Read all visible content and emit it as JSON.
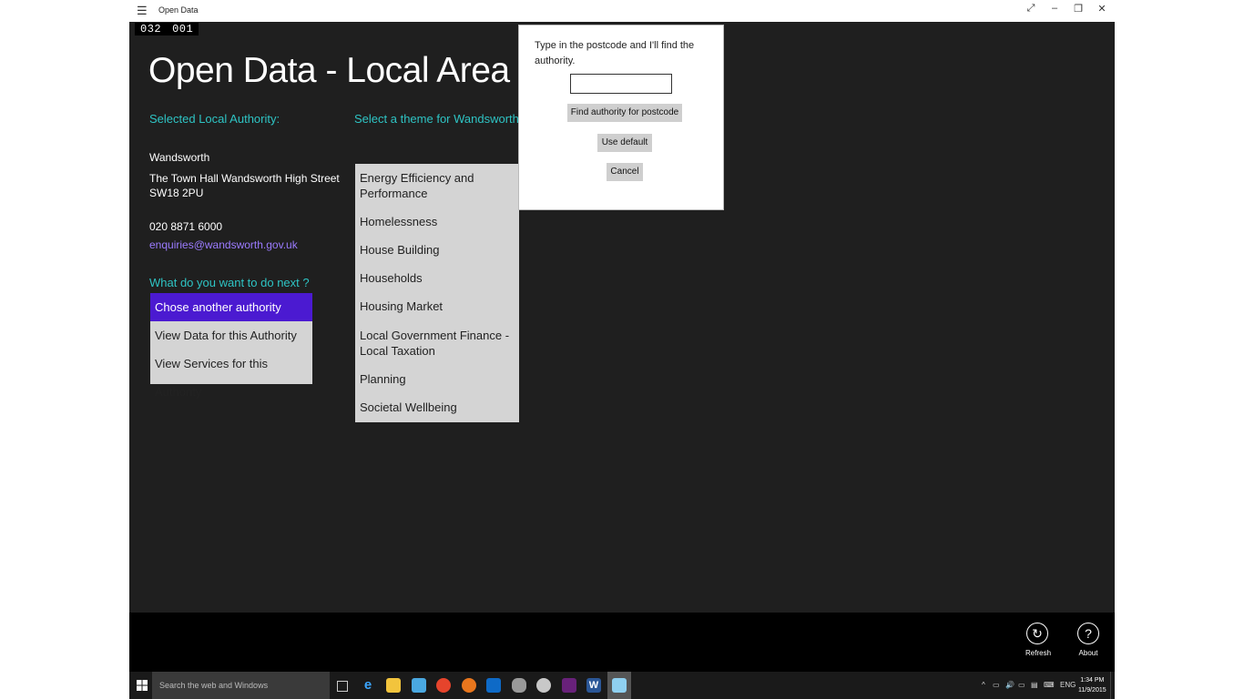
{
  "window": {
    "title": "Open Data",
    "menu_icon": "hamburger-icon",
    "controls": [
      {
        "name": "fullscreen",
        "glyph": "⤢"
      },
      {
        "name": "minimize",
        "glyph": "–"
      },
      {
        "name": "restore",
        "glyph": "❐"
      },
      {
        "name": "close",
        "glyph": "✕"
      }
    ]
  },
  "counter": {
    "a": "032",
    "b": "001"
  },
  "header": {
    "title": "Open Data - Local Area Services"
  },
  "authority": {
    "label": "Selected Local Authority:",
    "name": "Wandsworth",
    "address_line1": "The Town Hall Wandsworth High Street",
    "address_line2": "SW18 2PU",
    "phone": "020 8871 6000",
    "email": "enquiries@wandsworth.gov.uk"
  },
  "next": {
    "label": "What do you want to do next ?",
    "items": [
      {
        "label": "Chose another authority",
        "selected": true
      },
      {
        "label": "View Data for this Authority",
        "selected": false
      },
      {
        "label": "View Services for this Authority",
        "selected": false
      }
    ]
  },
  "themes": {
    "label": "Select a theme for Wandsworth :",
    "items": [
      {
        "label": "Energy Efficiency and Performance"
      },
      {
        "label": "Homelessness"
      },
      {
        "label": "House Building"
      },
      {
        "label": "Households"
      },
      {
        "label": "Housing Market"
      },
      {
        "label": "Local Government Finance - Local Taxation"
      },
      {
        "label": "Planning"
      },
      {
        "label": "Societal Wellbeing"
      }
    ]
  },
  "dialog": {
    "prompt": "Type in the postcode and I'll find the authority.",
    "input_value": "",
    "find_button": "Find authority for postcode",
    "default_button": "Use default",
    "cancel_button": "Cancel"
  },
  "appbar": {
    "refresh": {
      "label": "Refresh",
      "icon": "refresh-icon"
    },
    "about": {
      "label": "About",
      "icon": "help-icon"
    }
  },
  "taskbar": {
    "search_placeholder": "Search the web and Windows",
    "language": "ENG",
    "time": "1:34 PM",
    "date": "11/9/2015"
  },
  "colors": {
    "app_background": "#1f1f1f",
    "accent_label": "#2ec4c4",
    "selected_item": "#4b1ad1",
    "link": "#9b7bff",
    "list_background": "#d4d4d4"
  }
}
